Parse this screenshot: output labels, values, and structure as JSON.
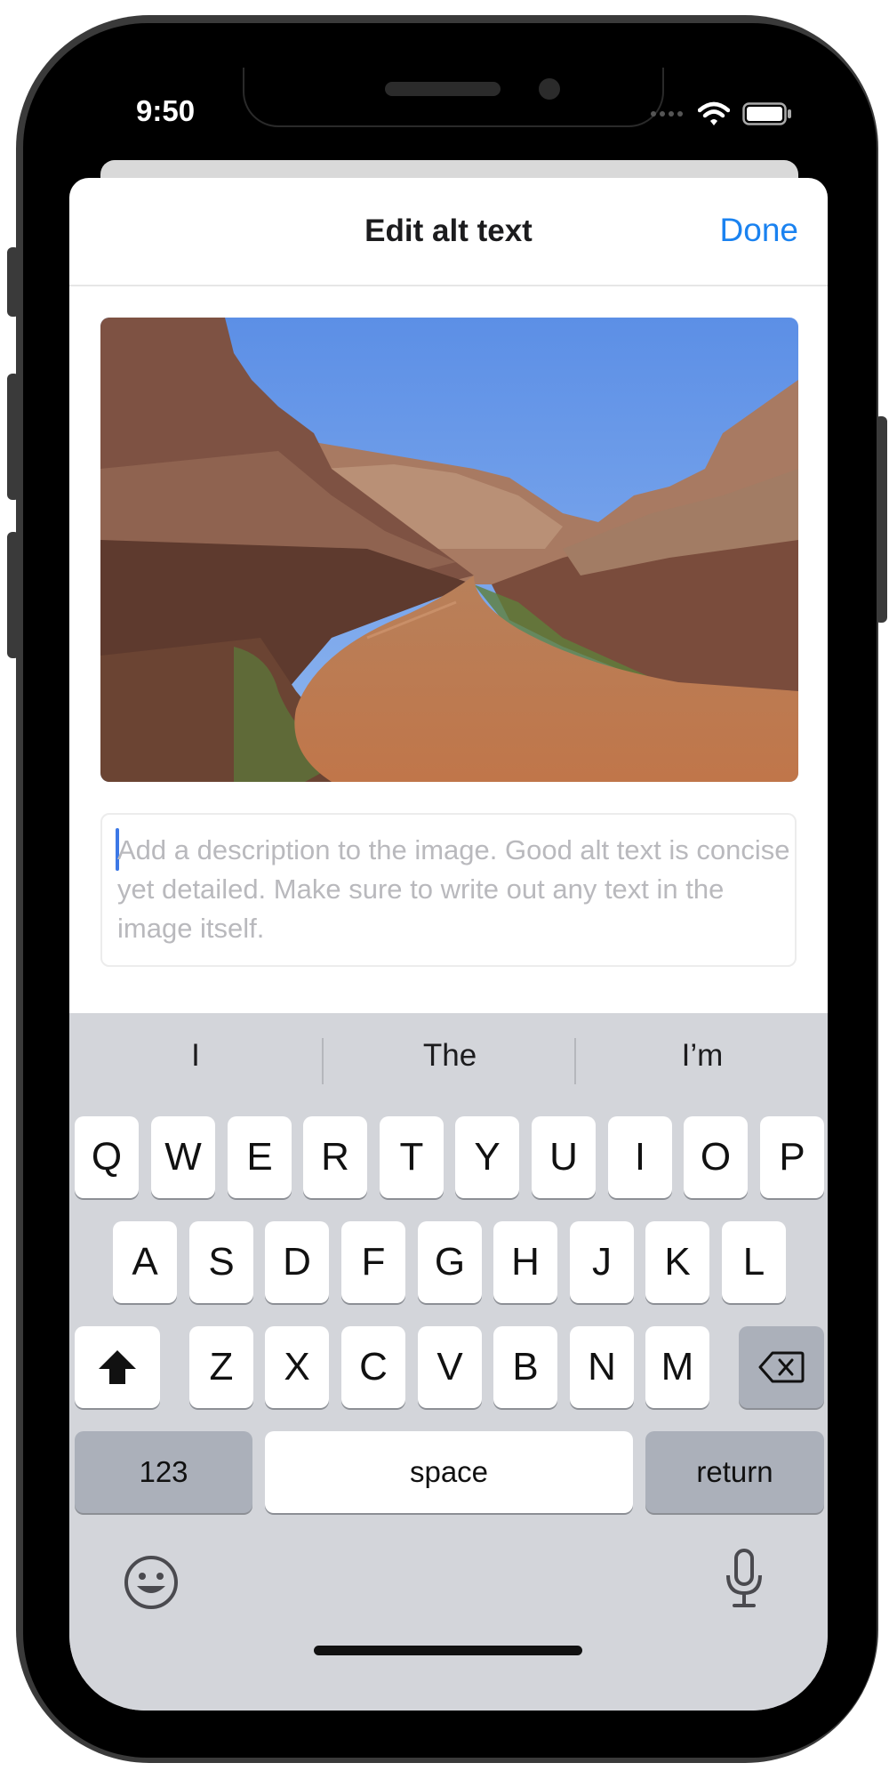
{
  "status_bar": {
    "time": "9:50"
  },
  "sheet": {
    "title": "Edit alt text",
    "done_label": "Done"
  },
  "alt_text": {
    "placeholder": "Add a description to the image. Good alt text is concise yet detailed. Make sure to write out any text in the image itself.",
    "value": ""
  },
  "keyboard": {
    "suggestions": [
      "I",
      "The",
      "I’m"
    ],
    "row1": [
      "Q",
      "W",
      "E",
      "R",
      "T",
      "Y",
      "U",
      "I",
      "O",
      "P"
    ],
    "row2": [
      "A",
      "S",
      "D",
      "F",
      "G",
      "H",
      "J",
      "K",
      "L"
    ],
    "row3": [
      "Z",
      "X",
      "C",
      "V",
      "B",
      "N",
      "M"
    ],
    "numbers_label": "123",
    "space_label": "space",
    "return_label": "return",
    "shift_icon": "shift-icon",
    "delete_icon": "backspace-icon",
    "emoji_icon": "emoji-icon",
    "mic_icon": "microphone-icon"
  },
  "colors": {
    "accent": "#1a82f0",
    "keyboard_bg": "#d3d5da"
  }
}
